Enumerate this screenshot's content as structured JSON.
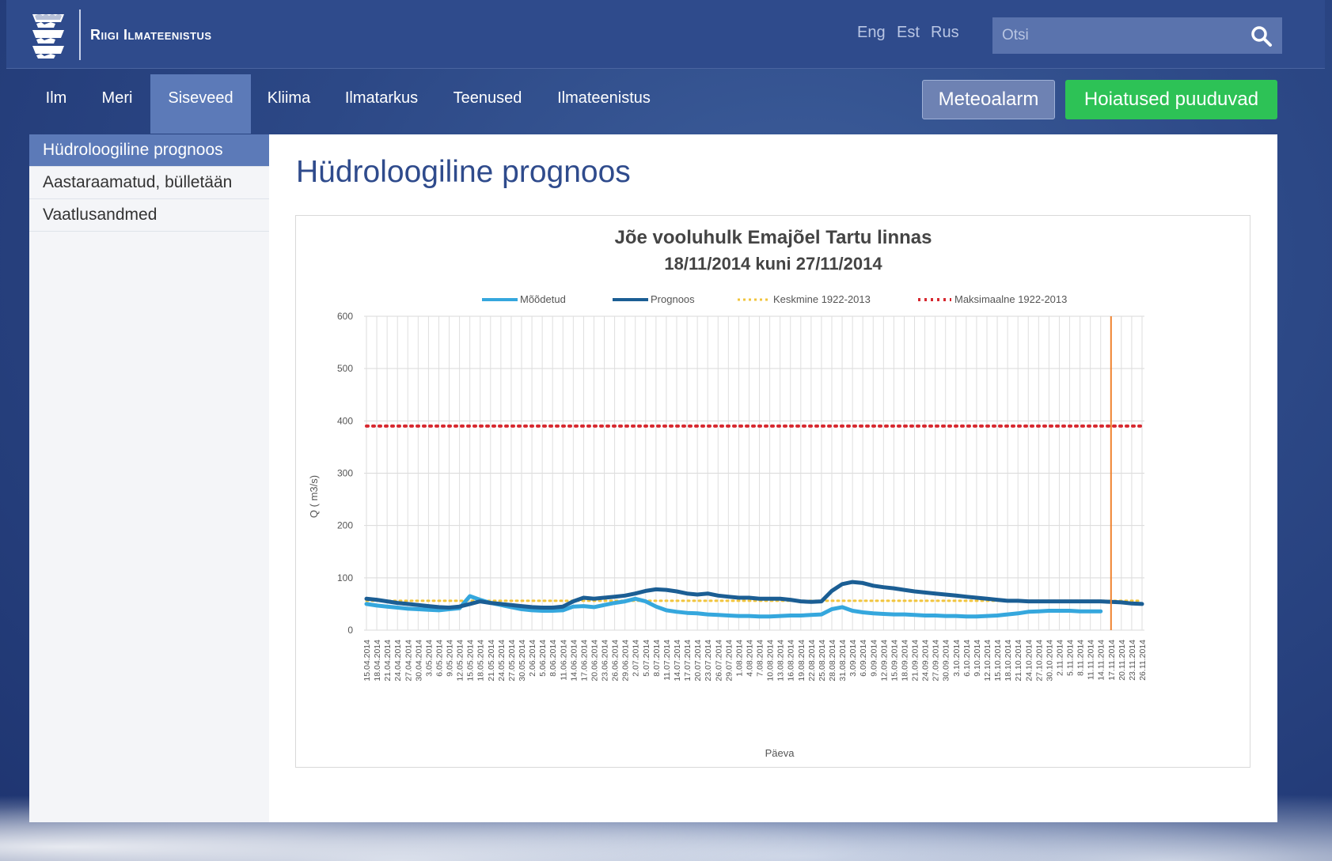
{
  "header": {
    "logo_text": "Riigi Ilmateenistus",
    "languages": [
      "Eng",
      "Est",
      "Rus"
    ],
    "search": {
      "placeholder": "Otsi"
    }
  },
  "nav": {
    "items": [
      "Ilm",
      "Meri",
      "Siseveed",
      "Kliima",
      "Ilmatarkus",
      "Teenused",
      "Ilmateenistus"
    ],
    "active": "Siseveed",
    "meteoalarm_label": "Meteoalarm",
    "warnings_label": "Hoiatused puuduvad"
  },
  "sidebar": {
    "items": [
      "Hüdroloogiline prognoos",
      "Aastaraamatud, bülletään",
      "Vaatlusandmed"
    ],
    "active": "Hüdroloogiline prognoos"
  },
  "main": {
    "title": "Hüdroloogiline prognoos"
  },
  "colors": {
    "header_bg": "#2f4b8c",
    "active_nav": "#5c7ab8",
    "warning_green": "#2dc256",
    "measured": "#35a7dd",
    "forecast": "#1b5e94",
    "average": "#f2c53d",
    "maximum": "#d7282f",
    "today_marker": "#f0822e"
  },
  "chart_data": {
    "type": "line",
    "title": "Jõe vooluhulk Emajõel Tartu linnas",
    "subtitle": "18/11/2014 kuni 27/11/2014",
    "xlabel": "Päeva",
    "ylabel": "Q ( m3/s)",
    "ylim": [
      0,
      600
    ],
    "yticks": [
      0,
      100,
      200,
      300,
      400,
      500,
      600
    ],
    "grid": true,
    "legend_position": "top",
    "x": [
      "15.04.2014",
      "18.04.2014",
      "21.04.2014",
      "24.04.2014",
      "27.04.2014",
      "30.04.2014",
      "3.05.2014",
      "6.05.2014",
      "9.05.2014",
      "12.05.2014",
      "15.05.2014",
      "18.05.2014",
      "21.05.2014",
      "24.05.2014",
      "27.05.2014",
      "30.05.2014",
      "2.06.2014",
      "5.06.2014",
      "8.06.2014",
      "11.06.2014",
      "14.06.2014",
      "17.06.2014",
      "20.06.2014",
      "23.06.2014",
      "26.06.2014",
      "29.06.2014",
      "2.07.2014",
      "5.07.2014",
      "8.07.2014",
      "11.07.2014",
      "14.07.2014",
      "17.07.2014",
      "20.07.2014",
      "23.07.2014",
      "26.07.2014",
      "29.07.2014",
      "1.08.2014",
      "4.08.2014",
      "7.08.2014",
      "10.08.2014",
      "13.08.2014",
      "16.08.2014",
      "19.08.2014",
      "22.08.2014",
      "25.08.2014",
      "28.08.2014",
      "31.08.2014",
      "3.09.2014",
      "6.09.2014",
      "9.09.2014",
      "12.09.2014",
      "15.09.2014",
      "18.09.2014",
      "21.09.2014",
      "24.09.2014",
      "27.09.2014",
      "30.09.2014",
      "3.10.2014",
      "6.10.2014",
      "9.10.2014",
      "12.10.2014",
      "15.10.2014",
      "18.10.2014",
      "21.10.2014",
      "24.10.2014",
      "27.10.2014",
      "30.10.2014",
      "2.11.2014",
      "5.11.2014",
      "8.11.2014",
      "11.11.2014",
      "14.11.2014",
      "17.11.2014",
      "20.11.2014",
      "23.11.2014",
      "26.11.2014"
    ],
    "today_marker_x": "17.11.2014",
    "series": [
      {
        "name": "Mõõdetud",
        "style": "solid",
        "values": [
          50,
          47,
          45,
          43,
          41,
          40,
          39,
          38,
          40,
          42,
          65,
          58,
          52,
          48,
          44,
          40,
          38,
          37,
          37,
          38,
          45,
          46,
          44,
          48,
          52,
          55,
          60,
          55,
          45,
          38,
          35,
          33,
          32,
          30,
          29,
          28,
          27,
          27,
          26,
          26,
          27,
          28,
          28,
          29,
          30,
          40,
          44,
          37,
          34,
          32,
          31,
          30,
          30,
          29,
          28,
          28,
          27,
          27,
          26,
          26,
          27,
          28,
          30,
          32,
          35,
          36,
          37,
          37,
          37,
          36,
          36,
          36,
          null,
          null,
          null,
          null
        ]
      },
      {
        "name": "Prognoos",
        "style": "solid",
        "values": [
          60,
          58,
          55,
          52,
          50,
          48,
          46,
          44,
          43,
          45,
          50,
          55,
          52,
          50,
          48,
          46,
          44,
          43,
          43,
          45,
          55,
          62,
          60,
          62,
          64,
          66,
          70,
          75,
          78,
          77,
          74,
          70,
          68,
          70,
          66,
          64,
          62,
          62,
          60,
          60,
          60,
          58,
          55,
          54,
          55,
          75,
          88,
          92,
          90,
          85,
          82,
          80,
          77,
          74,
          72,
          70,
          68,
          66,
          64,
          62,
          60,
          58,
          56,
          56,
          55,
          55,
          55,
          55,
          55,
          55,
          55,
          55,
          54,
          53,
          51,
          50
        ]
      },
      {
        "name": "Keskmine 1922-2013",
        "style": "dotted",
        "values": [
          56,
          56,
          56,
          56,
          56,
          56,
          56,
          56,
          56,
          56,
          56,
          56,
          56,
          56,
          56,
          56,
          56,
          56,
          56,
          56,
          56,
          56,
          56,
          56,
          56,
          56,
          56,
          56,
          56,
          56,
          56,
          56,
          56,
          56,
          56,
          56,
          56,
          56,
          56,
          56,
          56,
          56,
          56,
          56,
          56,
          56,
          56,
          56,
          56,
          56,
          56,
          56,
          56,
          56,
          56,
          56,
          56,
          56,
          56,
          56,
          56,
          56,
          56,
          56,
          56,
          56,
          56,
          56,
          56,
          56,
          56,
          56,
          56,
          56,
          56,
          56
        ]
      },
      {
        "name": "Maksimaalne 1922-2013",
        "style": "dotted",
        "values": [
          390,
          390,
          390,
          390,
          390,
          390,
          390,
          390,
          390,
          390,
          390,
          390,
          390,
          390,
          390,
          390,
          390,
          390,
          390,
          390,
          390,
          390,
          390,
          390,
          390,
          390,
          390,
          390,
          390,
          390,
          390,
          390,
          390,
          390,
          390,
          390,
          390,
          390,
          390,
          390,
          390,
          390,
          390,
          390,
          390,
          390,
          390,
          390,
          390,
          390,
          390,
          390,
          390,
          390,
          390,
          390,
          390,
          390,
          390,
          390,
          390,
          390,
          390,
          390,
          390,
          390,
          390,
          390,
          390,
          390,
          390,
          390,
          390,
          390,
          390,
          390
        ]
      }
    ]
  }
}
